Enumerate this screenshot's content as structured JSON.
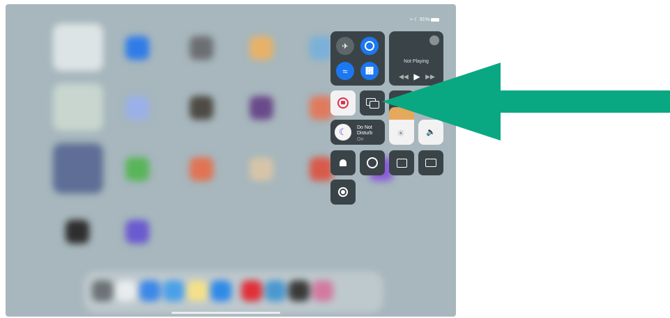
{
  "status_bar": {
    "battery": "91%"
  },
  "control_center": {
    "now_playing": {
      "title": "Not Playing"
    },
    "do_not_disturb": {
      "line1": "Do Not",
      "line2": "Disturb",
      "state": "On"
    }
  },
  "colors": {
    "accent_blue": "#1b78f2",
    "arrow_green": "#0aa882",
    "wallpaper": "#a7b7bd"
  }
}
